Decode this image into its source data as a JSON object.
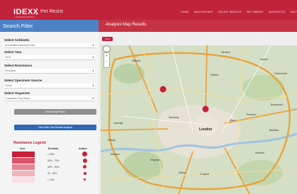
{
  "header": {
    "logo": "IDEXX",
    "logo_sub": "LABORATORIES",
    "app_name": "Pet Resist",
    "nav": [
      "HOME",
      "ANALYSIS MAP",
      "ISOLATE RESULTS",
      "PET LIBRARY",
      "ANTIBIOTICS",
      "HELP"
    ]
  },
  "sidebar": {
    "title": "Search Filter",
    "antibiotic": {
      "label": "Select Antibiotic",
      "value": "Amoxicillin/Clavulanic Acid"
    },
    "year": {
      "label": "Select Year",
      "value": "2015"
    },
    "resistance": {
      "label": "Select Resistance",
      "value": "Resistant"
    },
    "specimen": {
      "label": "Select Specimen Source",
      "value": "Feline"
    },
    "organism": {
      "label": "Select Organism",
      "value": "Coagulase Neg Staph."
    },
    "reset_button": "Reset Drop Filters",
    "view_button": "View Filter Test Results Analysis",
    "legend": {
      "title": "Resistance Legend",
      "col_area": "Area",
      "col_resistant": "Resistant",
      "col_isolates": "Isolates",
      "rows": [
        {
          "value": "> 80%",
          "color": "#c7203a"
        },
        {
          "value": "60% - 79%",
          "color": "#d9536a"
        },
        {
          "value": "40% - 59%",
          "color": "#e68493"
        },
        {
          "value": "20 - 39%",
          "color": "#f0b4bd"
        },
        {
          "value": "< 20%",
          "color": "#f9e0e4"
        }
      ]
    }
  },
  "main": {
    "title": "Analysis Map Results",
    "print_button": "Print",
    "map": {
      "zoom_in": "+",
      "zoom_out": "−",
      "labels": [
        {
          "text": "Watford"
        },
        {
          "text": "Harlow"
        },
        {
          "text": "Enfield"
        },
        {
          "text": "Hertford"
        },
        {
          "text": "Brentwood"
        },
        {
          "text": "Romford"
        },
        {
          "text": "Ilford"
        },
        {
          "text": "London"
        },
        {
          "text": "Chelmsford"
        },
        {
          "text": "Basildon"
        },
        {
          "text": "Wembley"
        },
        {
          "text": "Uxbridge"
        },
        {
          "text": "Slough"
        },
        {
          "text": "Windsor"
        },
        {
          "text": "Croydon"
        },
        {
          "text": "Dartford"
        },
        {
          "text": "Sutton"
        },
        {
          "text": "Kingston"
        }
      ]
    }
  }
}
